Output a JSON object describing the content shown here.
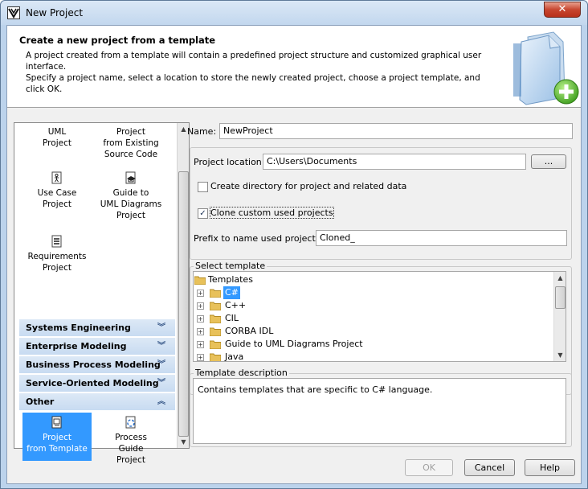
{
  "window": {
    "title": "New Project",
    "close_glyph": "✕"
  },
  "header": {
    "title": "Create a new project from a template",
    "description": "A project created from a template will contain a predefined project structure and customized graphical user interface.\nSpecify a project name, select a location to store the newly created project, choose a project template, and click OK."
  },
  "palette": {
    "items_top": [
      {
        "label": "UML\nProject",
        "icon": "uml-project-icon"
      },
      {
        "label": "Project\nfrom Existing\nSource Code",
        "icon": "source-code-project-icon"
      },
      {
        "label": "Use Case\nProject",
        "icon": "use-case-project-icon"
      },
      {
        "label": "Guide to\nUML Diagrams\nProject",
        "icon": "guide-project-icon"
      },
      {
        "label": "Requirements\nProject",
        "icon": "requirements-project-icon"
      }
    ],
    "categories": [
      {
        "label": "Systems Engineering",
        "state": "collapsed"
      },
      {
        "label": "Enterprise Modeling",
        "state": "collapsed"
      },
      {
        "label": "Business Process Modeling",
        "state": "collapsed"
      },
      {
        "label": "Service-Oriented Modeling",
        "state": "collapsed"
      },
      {
        "label": "Other",
        "state": "expanded"
      }
    ],
    "items_other": [
      {
        "label": "Project\nfrom Template",
        "icon": "template-project-icon",
        "selected": true
      },
      {
        "label": "Process\nGuide\nProject",
        "icon": "process-guide-icon",
        "selected": false
      }
    ]
  },
  "form": {
    "name_label": "Name:",
    "name_value": "NewProject",
    "location_label": "Project location:",
    "location_value": "C:\\Users\\Documents",
    "browse_label": "...",
    "create_dir_label": "Create directory for project and related data",
    "create_dir_checked": false,
    "clone_label": "Clone custom used projects",
    "clone_checked": true,
    "prefix_label": "Prefix to name used projects:",
    "prefix_value": "Cloned_"
  },
  "templates": {
    "group_label": "Select template",
    "root": "Templates",
    "items": [
      "C#",
      "C++",
      "CIL",
      "CORBA IDL",
      "Guide to UML Diagrams Project",
      "Java"
    ],
    "selected": "C#"
  },
  "description": {
    "group_label": "Template description",
    "text": "Contains templates that are specific to C# language."
  },
  "buttons": {
    "ok": "OK",
    "cancel": "Cancel",
    "help": "Help"
  },
  "colors": {
    "selection": "#3399ff",
    "category_bg": "#d2e2f4",
    "window_frame": "#bcd3ec"
  }
}
